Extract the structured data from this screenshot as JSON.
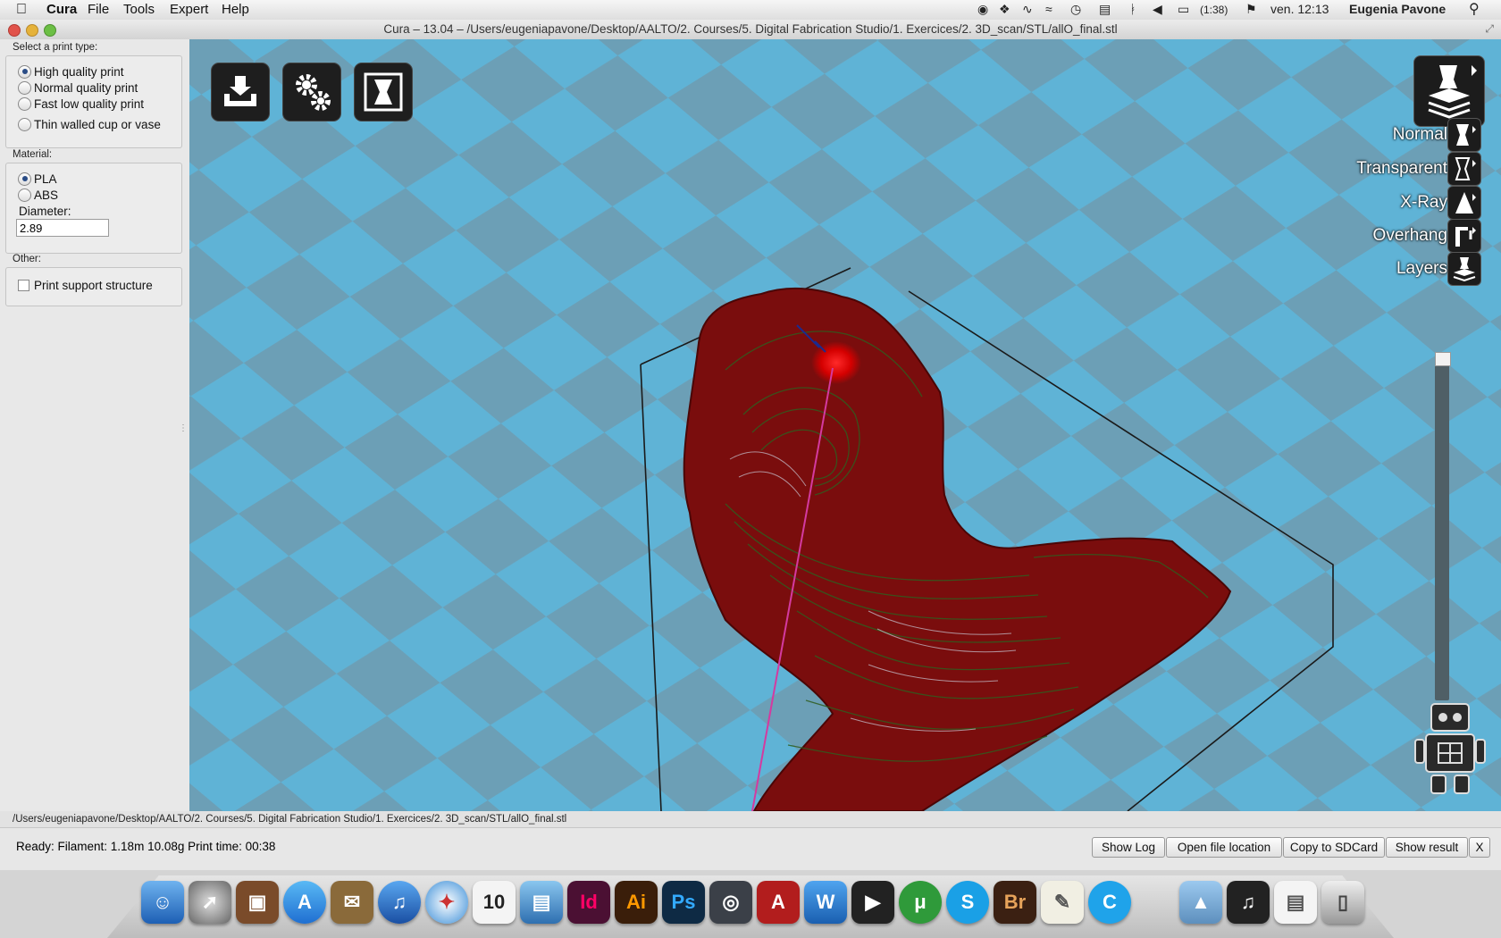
{
  "menubar": {
    "app_name": "Cura",
    "menus": [
      "File",
      "Tools",
      "Expert",
      "Help"
    ],
    "battery_time": "(1:38)",
    "clock": "ven. 12:13",
    "user": "Eugenia Pavone"
  },
  "window": {
    "title": "Cura – 13.04 – /Users/eugeniapavone/Desktop/AALTO/2. Courses/5. Digital Fabrication Studio/1. Exercices/2. 3D_scan/STL/allO_final.stl"
  },
  "sidebar": {
    "print_type_label": "Select a print type:",
    "print_types": [
      "High quality print",
      "Normal quality print",
      "Fast low quality print",
      "Thin walled cup or vase"
    ],
    "print_type_selected": "High quality print",
    "material_label": "Material:",
    "materials": [
      "PLA",
      "ABS"
    ],
    "material_selected": "PLA",
    "diameter_label": "Diameter:",
    "diameter_value": "2.89",
    "other_label": "Other:",
    "support_label": "Print support structure",
    "support_checked": false
  },
  "viewport": {
    "background_color": "#5fb3d6",
    "view_modes": [
      "Normal",
      "Transparent",
      "X-Ray",
      "Overhang",
      "Layers"
    ],
    "model_color": "#7a0d0d"
  },
  "statusbar": {
    "file_path": "/Users/eugeniapavone/Desktop/AALTO/2. Courses/5. Digital Fabrication Studio/1. Exercices/2. 3D_scan/STL/allO_final.stl",
    "status_text": "Ready: Filament: 1.18m 10.08g Print time: 00:38",
    "buttons": [
      "Show Log",
      "Open file location",
      "Copy to SDCard",
      "Show result",
      "X"
    ]
  },
  "dock": {
    "apps": [
      "Finder",
      "Launchpad",
      "Photo Booth",
      "App Store",
      "Mail",
      "iTunes",
      "Safari",
      "Calendar",
      "Remote Desktop",
      "InDesign",
      "Illustrator",
      "Photoshop",
      "Screenshot",
      "AutoCAD",
      "Word",
      "Final Cut",
      "uTorrent",
      "Skype",
      "Bridge",
      "TextEdit",
      "Cura",
      "Applications",
      "Music",
      "Documents",
      "Trash"
    ],
    "calendar_day": "10"
  }
}
